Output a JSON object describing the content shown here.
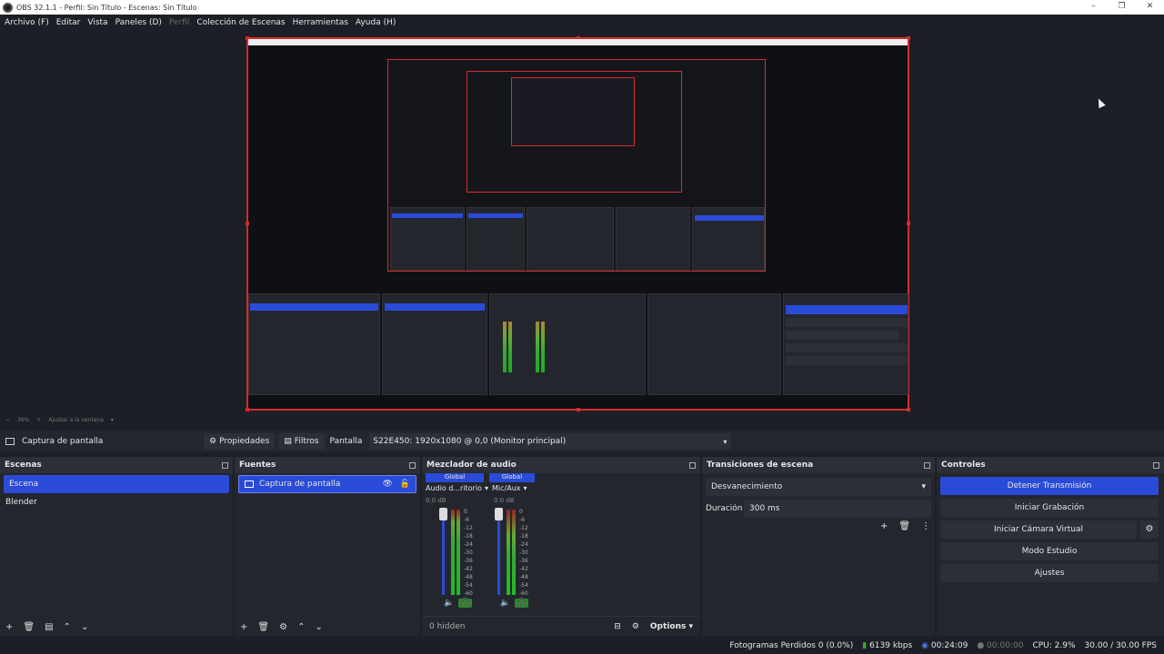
{
  "window": {
    "title": "OBS 32.1.1 - Perfil: Sin Título - Escenas: Sin Título",
    "minimize": "–",
    "maximize": "❐",
    "close": "✕"
  },
  "menu": [
    {
      "label": "Archivo (F)",
      "dim": false
    },
    {
      "label": "Editar",
      "dim": false
    },
    {
      "label": "Vista",
      "dim": false
    },
    {
      "label": "Paneles (D)",
      "dim": false
    },
    {
      "label": "Perfil",
      "dim": true
    },
    {
      "label": "Colección de Escenas",
      "dim": false
    },
    {
      "label": "Herramientas",
      "dim": false
    },
    {
      "label": "Ayuda (H)",
      "dim": false
    }
  ],
  "zoombar": {
    "minus": "−",
    "zoom": "36%",
    "plus": "+",
    "fit": "Ajustar a la ventana"
  },
  "source_bar": {
    "source_name": "Captura de pantalla",
    "properties": "Propiedades",
    "filters": "Filtros",
    "screen_label": "Pantalla",
    "screen_value": "S22E450: 1920x1080 @ 0,0 (Monitor principal)"
  },
  "scenes": {
    "title": "Escenas",
    "items": [
      "Escena",
      "Blender"
    ]
  },
  "sources": {
    "title": "Fuentes",
    "items": [
      "Captura de pantalla"
    ]
  },
  "mixer": {
    "title": "Mezclador de audio",
    "channels": [
      {
        "tag": "Global",
        "name": "Audio d...ritorio",
        "db": "0.0 dB"
      },
      {
        "tag": "Global",
        "name": "Mic/Aux",
        "db": "0.0 dB"
      }
    ],
    "scale": [
      "0",
      "-6",
      "-12",
      "-18",
      "-24",
      "-30",
      "-36",
      "-42",
      "-48",
      "-54",
      "-60"
    ],
    "hidden": "0 hidden",
    "options": "Options"
  },
  "transitions": {
    "title": "Transiciones de escena",
    "selected": "Desvanecimiento",
    "duration_label": "Duración",
    "duration_value": "300 ms"
  },
  "controls": {
    "title": "Controles",
    "stop_stream": "Detener Transmisión",
    "start_recording": "Iniciar Grabación",
    "start_virtualcam": "Iniciar Cámara Virtual",
    "studio_mode": "Modo Estudio",
    "settings": "Ajustes"
  },
  "status": {
    "dropped": "Fotogramas Perdidos 0 (0.0%)",
    "bitrate": "6139 kbps",
    "stream_time": "00:24:09",
    "record_time": "00:00:00",
    "cpu": "CPU: 2.9%",
    "fps": "30.00 / 30.00 FPS"
  },
  "colors": {
    "accent": "#2a4bd8",
    "selection_border": "#d62b2b",
    "meter_green": "#3a3",
    "bg": "#1d1f26"
  }
}
